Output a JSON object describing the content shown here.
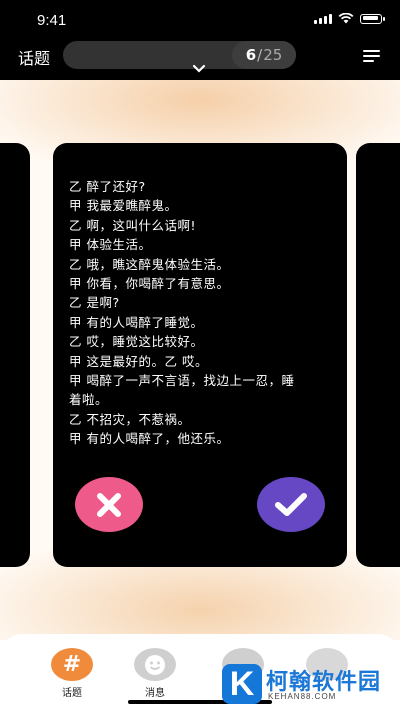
{
  "status_bar": {
    "time": "9:41"
  },
  "header": {
    "title": "话题",
    "progress_current": "6",
    "progress_separator": "/",
    "progress_total": "25"
  },
  "card": {
    "lines": [
      "乙 醉了还好?",
      "甲 我最爱瞧醉鬼。",
      "乙 啊，这叫什么话啊!",
      "甲 体验生活。",
      "乙 哦，瞧这醉鬼体验生活。",
      "甲 你看，你喝醉了有意思。",
      "乙 是啊?",
      "甲 有的人喝醉了睡觉。",
      "乙 哎，睡觉这比较好。",
      "甲 这是最好的。乙 哎。",
      "甲 喝醉了一声不言语，找边上一忍，睡",
      "着啦。",
      "乙 不招灾，不惹祸。",
      "甲 有的人喝醉了，他还乐。"
    ]
  },
  "tabs": {
    "topic": {
      "icon": "#",
      "label": "话题"
    },
    "messages": {
      "label": "消息"
    }
  },
  "watermark": {
    "logo_letter": "K",
    "name": "柯翰软件园",
    "url": "KEHAN88.COM"
  },
  "colors": {
    "accent": "#f08b3c",
    "reject": "#ee5a8a",
    "accept": "#6648c4"
  }
}
